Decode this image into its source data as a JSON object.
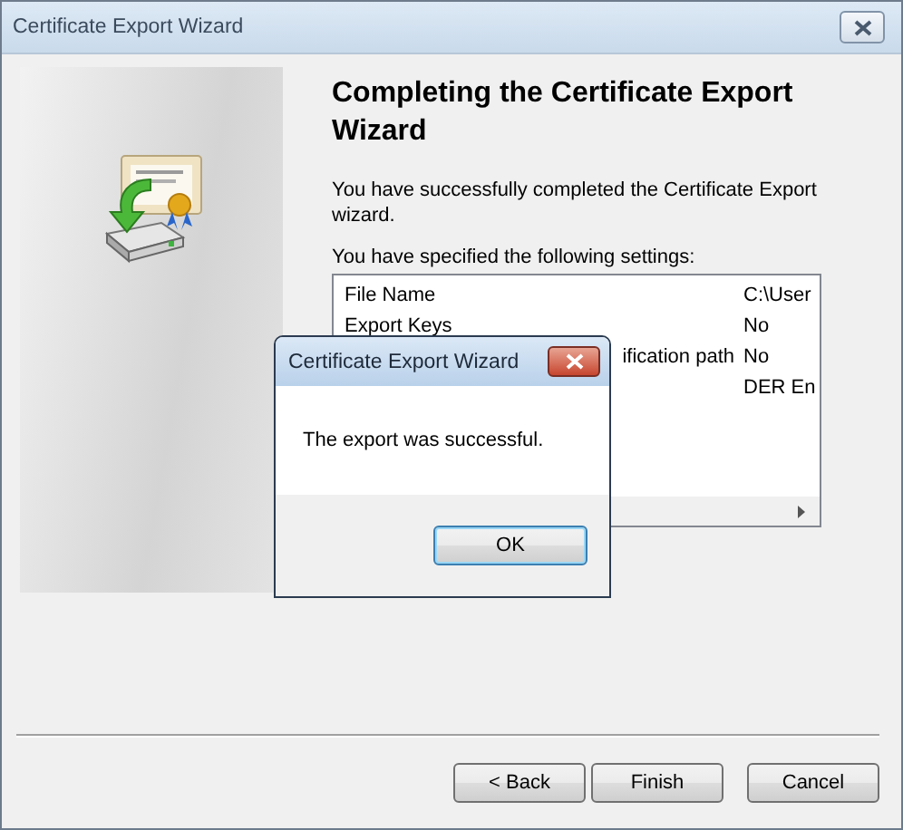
{
  "window": {
    "title": "Certificate Export Wizard"
  },
  "heading": "Completing the Certificate Export Wizard",
  "intro": "You have successfully completed the Certificate Export wizard.",
  "settings_label": "You have specified the following settings:",
  "settings": [
    {
      "setting": "File Name",
      "value": "C:\\User"
    },
    {
      "setting": "Export Keys",
      "value": "No"
    },
    {
      "setting": "ification path",
      "value": "No",
      "clipped_left": true
    },
    {
      "value": "DER En"
    }
  ],
  "buttons": [
    {
      "label": "< Back",
      "kind": "back"
    },
    {
      "label": "Finish",
      "kind": "finish"
    },
    {
      "label": "Cancel",
      "kind": "cancel"
    }
  ],
  "dialog": {
    "title": "Certificate Export Wizard",
    "message": "The export was successful.",
    "button": {
      "label": "OK",
      "focused": true
    }
  }
}
